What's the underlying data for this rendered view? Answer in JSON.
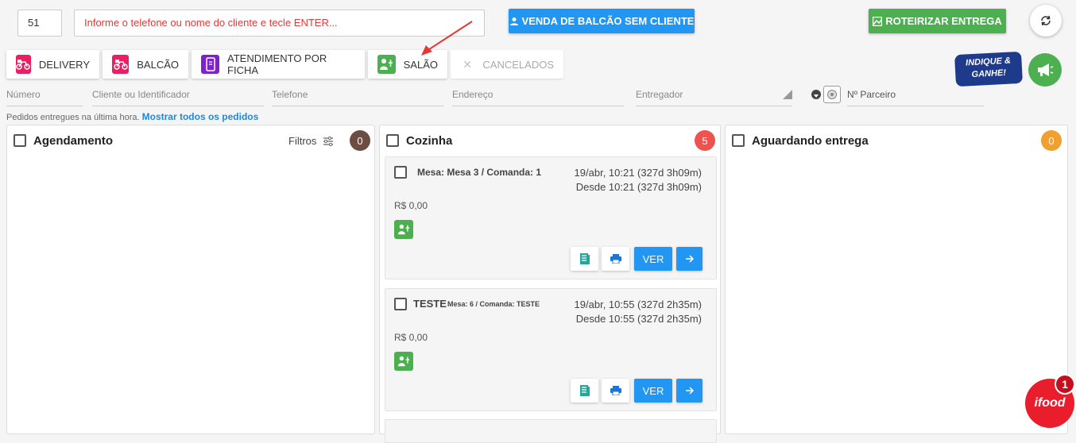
{
  "topbar": {
    "code_value": "51",
    "search_placeholder": "Informe o telefone ou nome do cliente e tecle ENTER...",
    "venda_balcao_label": "VENDA DE BALCÃO SEM CLIENTE",
    "roteirizar_label": "ROTEIRIZAR ENTREGA"
  },
  "tabs": {
    "delivery": "DELIVERY",
    "balcao": "BALCÃO",
    "ficha": "ATENDIMENTO POR FICHA",
    "salao": "SALÃO",
    "cancelados": "CANCELADOS"
  },
  "filters": {
    "numero": "Número",
    "cliente": "Cliente ou Identificador",
    "telefone": "Telefone",
    "endereco": "Endereço",
    "entregador": "Entregador",
    "parceiro": "Nº Parceiro"
  },
  "hint": {
    "text": "Pedidos entregues na última hora.",
    "link": "Mostrar todos os pedidos"
  },
  "promo": {
    "line1": "INDIQUE &",
    "line2": "GANHE!"
  },
  "ifood": {
    "label": "ifood",
    "badge": "1"
  },
  "columns": {
    "agendamento": {
      "title": "Agendamento",
      "filtros_label": "Filtros",
      "count": "0",
      "color": "#6d4c41"
    },
    "cozinha": {
      "title": "Cozinha",
      "count": "5",
      "color": "#ef5350"
    },
    "aguardando": {
      "title": "Aguardando entrega",
      "count": "0",
      "color": "#f0a030"
    }
  },
  "orders": [
    {
      "title": "Mesa: Mesa 3 / Comanda: 1",
      "date": "19/abr, 10:21 (327d 3h09m)",
      "since": "Desde 10:21 (327d 3h09m)",
      "price": "R$ 0,00",
      "ver_label": "VER"
    },
    {
      "name": "TESTE",
      "title": "Mesa: 6 / Comanda: TESTE",
      "date": "19/abr, 10:55 (327d 2h35m)",
      "since": "Desde 10:55 (327d 2h35m)",
      "price": "R$ 0,00",
      "ver_label": "VER"
    }
  ],
  "colors": {
    "primary_blue": "#2196f3",
    "green": "#4caf50",
    "delivery_pink": "#e91e63",
    "ficha_purple": "#7e22ce",
    "ifood_red": "#ea1d2c"
  }
}
